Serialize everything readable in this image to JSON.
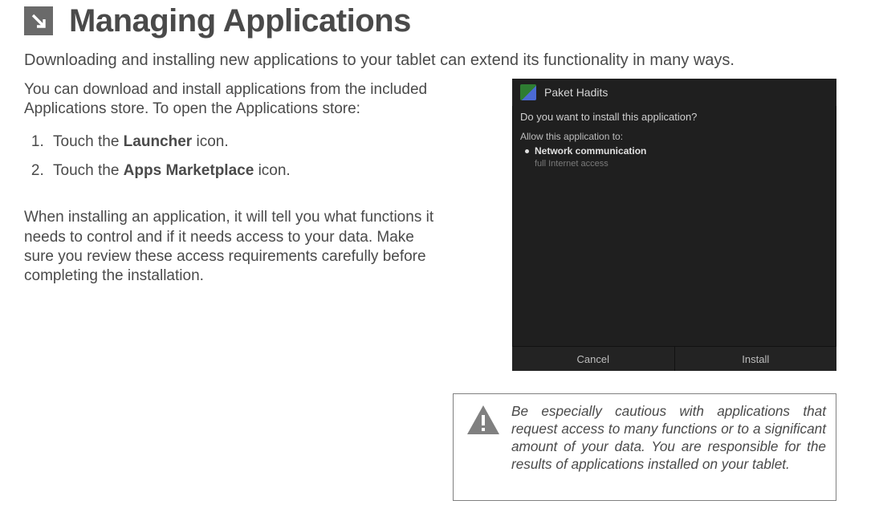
{
  "header": {
    "title": "Managing Applications"
  },
  "lead": "Downloading and installing new applications to your tablet can extend its functionality in many ways.",
  "left": {
    "intro": "You can download and install applications from the included Applications store. To open the Applications store:",
    "step1_pre": "Touch the ",
    "step1_bold": "Launcher",
    "step1_post": " icon.",
    "step2_pre": "Touch the ",
    "step2_bold": "Apps Marketplace",
    "step2_post": " icon.",
    "para2": "When installing an application, it will tell you what functions it needs to control and if it needs access to your data. Make sure you review these access requirements carefully before completing the installation."
  },
  "shot": {
    "appname": "Paket Hadits",
    "question": "Do you want to install this application?",
    "allow": "Allow this application to:",
    "perm1_title": "Network communication",
    "perm1_sub": "full Internet access",
    "cancel": "Cancel",
    "install": "Install"
  },
  "caution": {
    "text": "Be especially cautious with applications that request access to many functions or to a significant amount of your data. You are responsible for the results of applications installed on your tablet."
  }
}
